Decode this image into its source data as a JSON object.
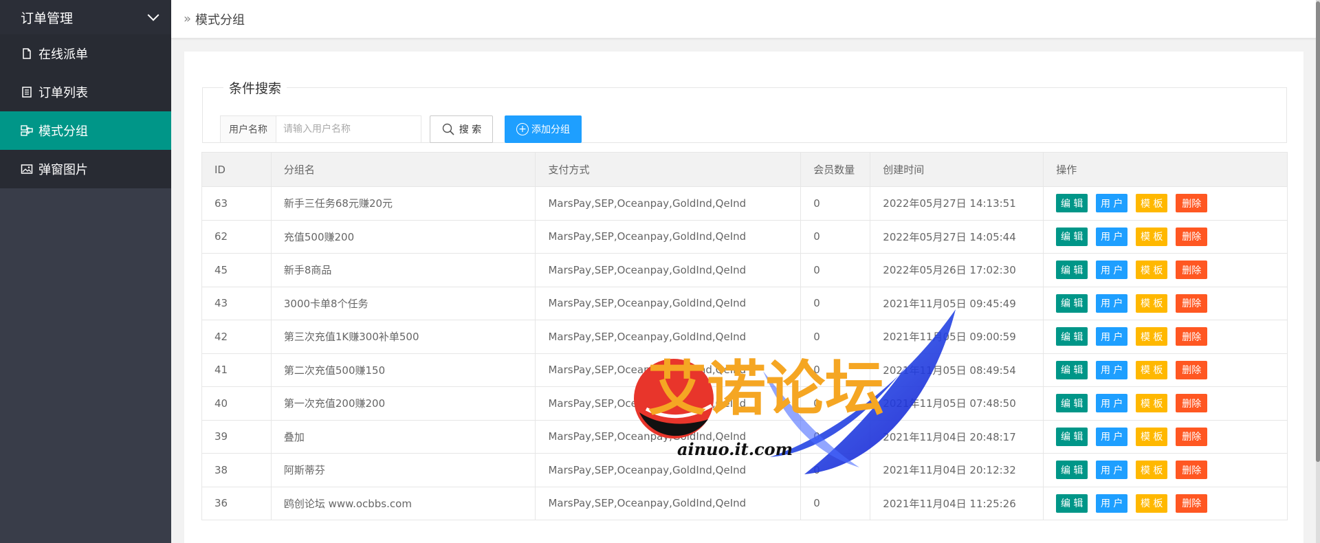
{
  "sidebar": {
    "group_label": "订单管理",
    "items": [
      {
        "label": "在线派单",
        "icon": "file-icon",
        "active": false
      },
      {
        "label": "订单列表",
        "icon": "list-icon",
        "active": false
      },
      {
        "label": "模式分组",
        "icon": "group-icon",
        "active": true
      },
      {
        "label": "弹窗图片",
        "icon": "image-icon",
        "active": false
      }
    ]
  },
  "header": {
    "breadcrumb": "模式分组"
  },
  "search": {
    "legend": "条件搜索",
    "field_label": "用户名称",
    "placeholder": "请输入用户名称",
    "search_label": "搜 索",
    "add_label": "添加分组"
  },
  "table": {
    "columns": [
      "ID",
      "分组名",
      "支付方式",
      "会员数量",
      "创建时间",
      "操作"
    ],
    "rows": [
      {
        "id": "63",
        "name": "新手三任务68元赚20元",
        "pay": "MarsPay,SEP,Oceanpay,GoldInd,QeInd",
        "count": "0",
        "time": "2022年05月27日 14:13:51"
      },
      {
        "id": "62",
        "name": "充值500赚200",
        "pay": "MarsPay,SEP,Oceanpay,GoldInd,QeInd",
        "count": "0",
        "time": "2022年05月27日 14:05:44"
      },
      {
        "id": "45",
        "name": "新手8商品",
        "pay": "MarsPay,SEP,Oceanpay,GoldInd,QeInd",
        "count": "0",
        "time": "2022年05月26日 17:02:30"
      },
      {
        "id": "43",
        "name": "3000卡单8个任务",
        "pay": "MarsPay,SEP,Oceanpay,GoldInd,QeInd",
        "count": "0",
        "time": "2021年11月05日 09:45:49"
      },
      {
        "id": "42",
        "name": "第三次充值1K赚300补单500",
        "pay": "MarsPay,SEP,Oceanpay,GoldInd,QeInd",
        "count": "0",
        "time": "2021年11月05日 09:00:59"
      },
      {
        "id": "41",
        "name": "第二次充值500赚150",
        "pay": "MarsPay,SEP,Oceanpay,GoldInd,QeInd",
        "count": "0",
        "time": "2021年11月05日 08:49:54"
      },
      {
        "id": "40",
        "name": "第一次充值200赚200",
        "pay": "MarsPay,SEP,Oceanpay,GoldInd,QeInd",
        "count": "0",
        "time": "2021年11月05日 07:48:50"
      },
      {
        "id": "39",
        "name": "叠加",
        "pay": "MarsPay,SEP,Oceanpay,GoldInd,QeInd",
        "count": "0",
        "time": "2021年11月04日 20:48:17"
      },
      {
        "id": "38",
        "name": "阿斯蒂芬",
        "pay": "MarsPay,SEP,Oceanpay,GoldInd,QeInd",
        "count": "0",
        "time": "2021年11月04日 20:12:32"
      },
      {
        "id": "36",
        "name": "鸥创论坛 www.ocbbs.com",
        "pay": "MarsPay,SEP,Oceanpay,GoldInd,QeInd",
        "count": "0",
        "time": "2021年11月04日 11:25:26"
      }
    ],
    "actions": {
      "edit": "编 辑",
      "user": "用 户",
      "template": "模 板",
      "delete": "删除"
    }
  },
  "watermark": {
    "title": "艾诺论坛",
    "url": "ainuo.it.com"
  },
  "colors": {
    "sidebar": "#393d49",
    "active": "#009688",
    "blue": "#1e9fff",
    "orange": "#ffb800",
    "red": "#ff5722"
  }
}
